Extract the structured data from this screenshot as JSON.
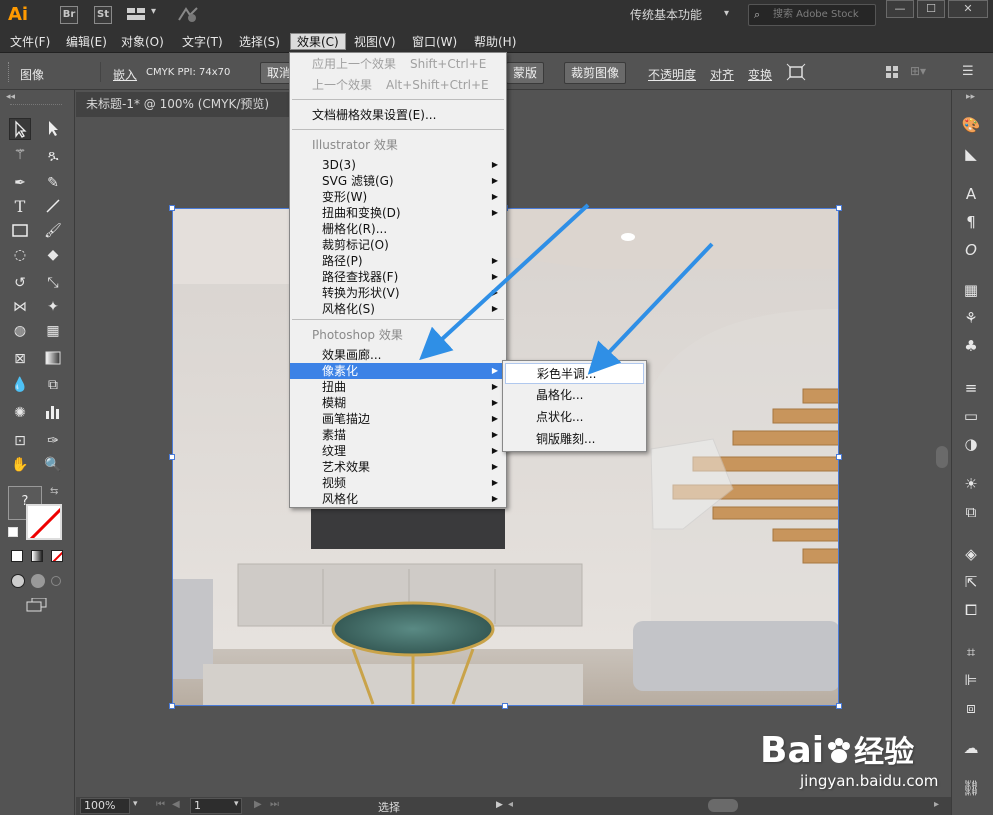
{
  "titlebar": {
    "logo": "Ai",
    "badges": [
      "Br",
      "St"
    ],
    "workspace": "传统基本功能",
    "search_placeholder": "搜索 Adobe Stock"
  },
  "menubar": {
    "items": [
      "文件(F)",
      "编辑(E)",
      "对象(O)",
      "文字(T)",
      "选择(S)",
      "效果(C)",
      "视图(V)",
      "窗口(W)",
      "帮助(H)"
    ],
    "active": "效果(C)"
  },
  "controlbar": {
    "label": "图像",
    "embed": "嵌入",
    "info": "CMYK  PPI: 74x70",
    "cancel_button": "取消",
    "mask_button": "蒙版",
    "crop_button": "裁剪图像",
    "opacity": "不透明度",
    "align": "对齐",
    "transform": "变换"
  },
  "document": {
    "tab_title": "未标题-1* @ 100% (CMYK/预览)"
  },
  "effect_menu": {
    "apply_last": "应用上一个效果",
    "apply_last_shortcut": "Shift+Ctrl+E",
    "last_effect": "上一个效果",
    "last_effect_shortcut": "Alt+Shift+Ctrl+E",
    "doc_raster": "文档栅格效果设置(E)...",
    "illustrator_section": "Illustrator 效果",
    "illustrator_items": [
      "3D(3)",
      "SVG 滤镜(G)",
      "变形(W)",
      "扭曲和变换(D)",
      "栅格化(R)...",
      "裁剪标记(O)",
      "路径(P)",
      "路径查找器(F)",
      "转换为形状(V)",
      "风格化(S)"
    ],
    "photoshop_section": "Photoshop 效果",
    "photoshop_items": [
      "效果画廊...",
      "像素化",
      "扭曲",
      "模糊",
      "画笔描边",
      "素描",
      "纹理",
      "艺术效果",
      "视频",
      "风格化"
    ],
    "highlighted": "像素化"
  },
  "submenu": {
    "items": [
      "彩色半调...",
      "晶格化...",
      "点状化...",
      "铜版雕刻..."
    ]
  },
  "statusbar": {
    "zoom": "100%",
    "page": "1",
    "tool": "选择"
  },
  "watermark": {
    "brand": "Bai",
    "brand_cn": "经验",
    "url": "jingyan.baidu.com"
  },
  "colors": {
    "accent": "#3c82e6",
    "arrow": "#2f8fe6",
    "ai_orange": "#ff9a00"
  }
}
